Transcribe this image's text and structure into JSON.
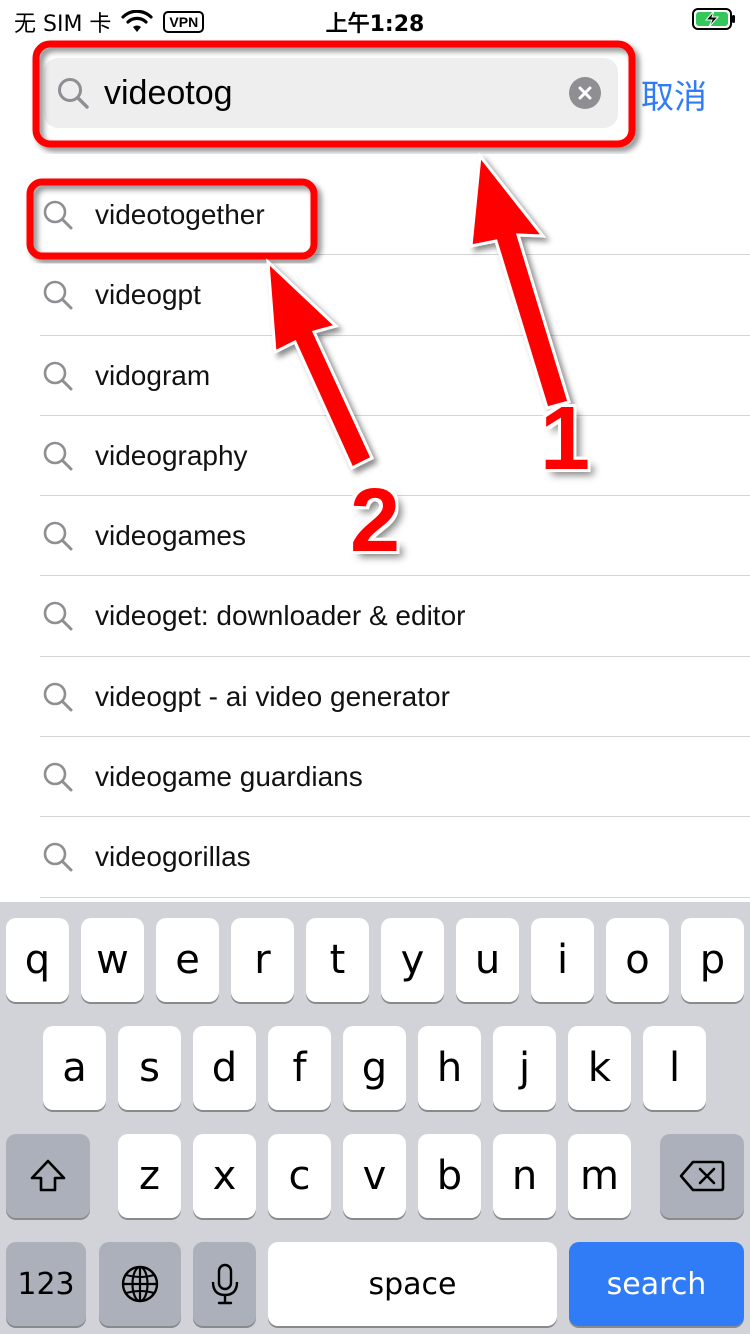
{
  "status_bar": {
    "carrier": "无 SIM 卡",
    "vpn": "VPN",
    "time": "上午1:28",
    "wifi_icon": "wifi-icon",
    "battery_icon": "battery-charging-icon"
  },
  "search": {
    "query": "videotog",
    "cancel_label": "取消",
    "clear_icon": "clear-icon",
    "search_icon": "search-icon"
  },
  "suggestions": [
    "videotogether",
    "videogpt",
    "vidogram",
    "videography",
    "videogames",
    "videoget: downloader & editor",
    "videogpt - ai video generator",
    "videogame guardians",
    "videogorillas"
  ],
  "annotations": {
    "label_1": "1",
    "label_2": "2",
    "color": "#ff0000"
  },
  "keyboard": {
    "row1": [
      "q",
      "w",
      "e",
      "r",
      "t",
      "y",
      "u",
      "i",
      "o",
      "p"
    ],
    "row2": [
      "a",
      "s",
      "d",
      "f",
      "g",
      "h",
      "j",
      "k",
      "l"
    ],
    "row3": [
      "z",
      "x",
      "c",
      "v",
      "b",
      "n",
      "m"
    ],
    "numbers_label": "123",
    "space_label": "space",
    "search_label": "search",
    "shift_icon": "shift-icon",
    "delete_icon": "delete-icon",
    "globe_icon": "globe-icon",
    "mic_icon": "microphone-icon",
    "accent_color": "#2f7cf6"
  }
}
